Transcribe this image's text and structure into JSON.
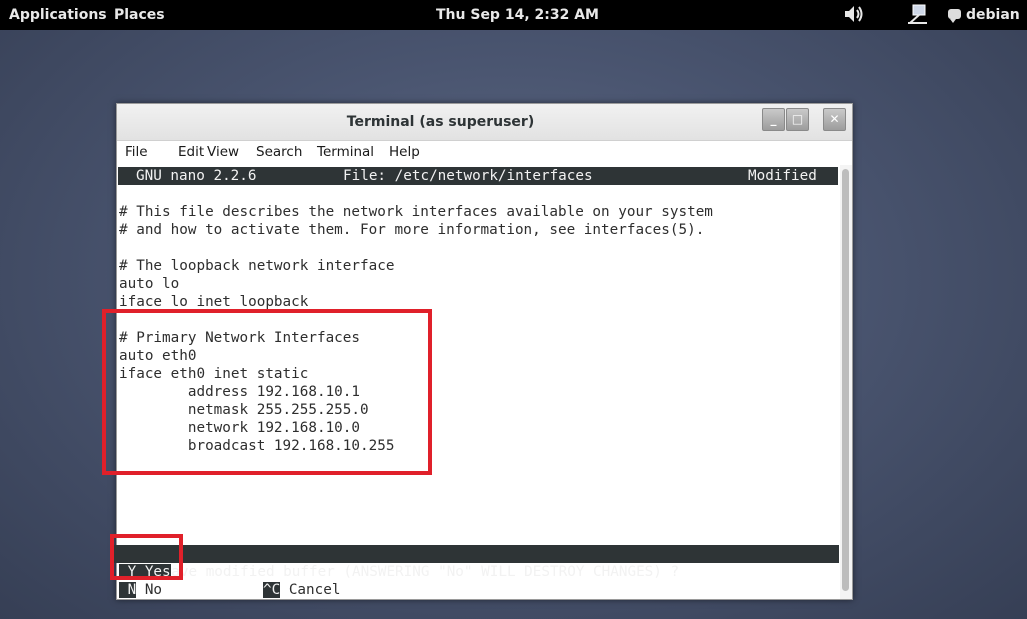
{
  "topbar": {
    "applications": "Applications",
    "places": "Places",
    "clock": "Thu Sep 14,  2:32 AM",
    "volume_icon": "🔊",
    "network_icon": "network-icon",
    "user": "debian"
  },
  "window": {
    "title": "Terminal (as superuser)",
    "buttons": {
      "minimize": "_",
      "maximize": "□",
      "close": "✕"
    },
    "menu": [
      "File",
      "Edit",
      "View",
      "Search",
      "Terminal",
      "Help"
    ]
  },
  "nano": {
    "version": "GNU nano 2.2.6",
    "file": "File: /etc/network/interfaces",
    "status": "Modified"
  },
  "file_lines": [
    "# This file describes the network interfaces available on your system",
    "# and how to activate them. For more information, see interfaces(5).",
    "",
    "# The loopback network interface",
    "auto lo",
    "iface lo inet loopback",
    "",
    "# Primary Network Interfaces",
    "auto eth0",
    "iface eth0 inet static",
    "        address 192.168.10.1",
    "        netmask 255.255.255.0",
    "        network 192.168.10.0",
    "        broadcast 192.168.10.255"
  ],
  "prompt": {
    "question": "Save modified buffer (ANSWERING \"No\" WILL DESTROY CHANGES) ? ",
    "options": [
      {
        "key": " Y",
        "label": " Yes"
      },
      {
        "key": " N",
        "label": " No"
      },
      {
        "key": "^C",
        "label": " Cancel"
      }
    ]
  },
  "colors": {
    "annotation": "#e0202a",
    "terminal_inverse": "#2e3436"
  }
}
